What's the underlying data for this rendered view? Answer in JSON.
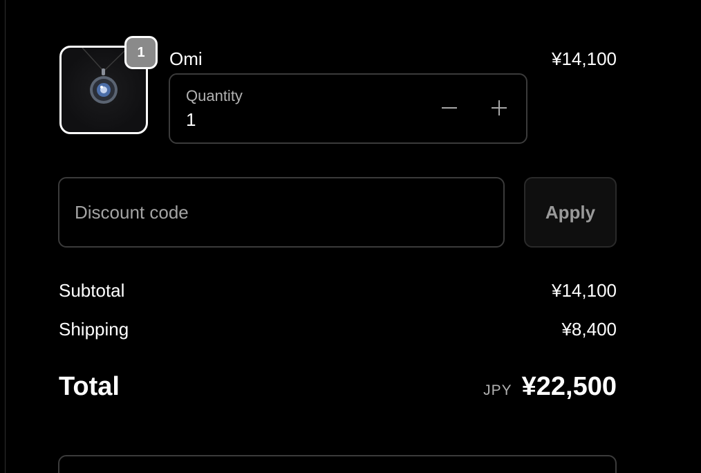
{
  "line_item": {
    "name": "Omi",
    "price": "¥14,100",
    "quantity_badge": "1",
    "quantity_label": "Quantity",
    "quantity_value": "1",
    "decrease_icon": "minus-icon",
    "increase_icon": "plus-icon"
  },
  "discount": {
    "placeholder": "Discount code",
    "apply_label": "Apply"
  },
  "summary": {
    "subtotal_label": "Subtotal",
    "subtotal_value": "¥14,100",
    "shipping_label": "Shipping",
    "shipping_value": "¥8,400",
    "total_label": "Total",
    "currency": "JPY",
    "total_value": "¥22,500"
  },
  "colors": {
    "background": "#000000",
    "border": "#3b3b3b",
    "muted_text": "#a3a3a3",
    "badge": "#8a8a8a"
  }
}
